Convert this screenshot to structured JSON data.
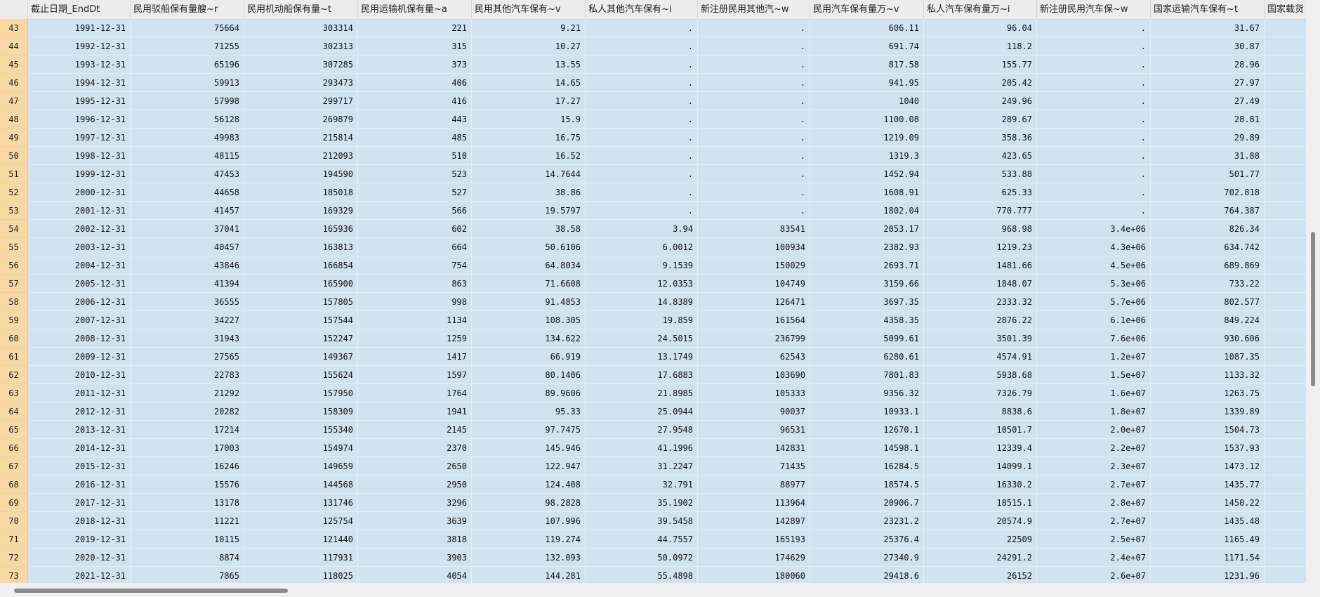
{
  "grid": {
    "columns": [
      "截止日期_EndDt",
      "民用驳船保有量艘~r",
      "民用机动船保有量~t",
      "民用运输机保有量~a",
      "民用其他汽车保有~v",
      "私人其他汽车保有~i",
      "新注册民用其他汽~w",
      "民用汽车保有量万~v",
      "私人汽车保有量万~i",
      "新注册民用汽车保~w",
      "国家运输汽车保有~t",
      "国家载货"
    ],
    "rows": [
      {
        "num": "43",
        "cells": [
          "1991-12-31",
          "75664",
          "303314",
          "221",
          "9.21",
          ".",
          ".",
          "606.11",
          "96.04",
          ".",
          "31.67",
          ""
        ]
      },
      {
        "num": "44",
        "cells": [
          "1992-12-31",
          "71255",
          "302313",
          "315",
          "10.27",
          ".",
          ".",
          "691.74",
          "118.2",
          ".",
          "30.87",
          ""
        ]
      },
      {
        "num": "45",
        "cells": [
          "1993-12-31",
          "65196",
          "307285",
          "373",
          "13.55",
          ".",
          ".",
          "817.58",
          "155.77",
          ".",
          "28.96",
          ""
        ]
      },
      {
        "num": "46",
        "cells": [
          "1994-12-31",
          "59913",
          "293473",
          "406",
          "14.65",
          ".",
          ".",
          "941.95",
          "205.42",
          ".",
          "27.97",
          ""
        ]
      },
      {
        "num": "47",
        "cells": [
          "1995-12-31",
          "57998",
          "299717",
          "416",
          "17.27",
          ".",
          ".",
          "1040",
          "249.96",
          ".",
          "27.49",
          ""
        ]
      },
      {
        "num": "48",
        "cells": [
          "1996-12-31",
          "56128",
          "269879",
          "443",
          "15.9",
          ".",
          ".",
          "1100.08",
          "289.67",
          ".",
          "28.81",
          ""
        ]
      },
      {
        "num": "49",
        "cells": [
          "1997-12-31",
          "49983",
          "215814",
          "485",
          "16.75",
          ".",
          ".",
          "1219.09",
          "358.36",
          ".",
          "29.89",
          ""
        ]
      },
      {
        "num": "50",
        "cells": [
          "1998-12-31",
          "48115",
          "212093",
          "510",
          "16.52",
          ".",
          ".",
          "1319.3",
          "423.65",
          ".",
          "31.88",
          ""
        ]
      },
      {
        "num": "51",
        "cells": [
          "1999-12-31",
          "47453",
          "194590",
          "523",
          "14.7644",
          ".",
          ".",
          "1452.94",
          "533.88",
          ".",
          "501.77",
          ""
        ]
      },
      {
        "num": "52",
        "cells": [
          "2000-12-31",
          "44658",
          "185018",
          "527",
          "38.86",
          ".",
          ".",
          "1608.91",
          "625.33",
          ".",
          "702.818",
          ""
        ]
      },
      {
        "num": "53",
        "cells": [
          "2001-12-31",
          "41457",
          "169329",
          "566",
          "19.5797",
          ".",
          ".",
          "1802.04",
          "770.777",
          ".",
          "764.387",
          ""
        ]
      },
      {
        "num": "54",
        "cells": [
          "2002-12-31",
          "37041",
          "165936",
          "602",
          "38.58",
          "3.94",
          "83541",
          "2053.17",
          "968.98",
          "3.4e+06",
          "826.34",
          ""
        ]
      },
      {
        "num": "55",
        "cells": [
          "2003-12-31",
          "40457",
          "163813",
          "664",
          "50.6106",
          "6.0012",
          "100934",
          "2382.93",
          "1219.23",
          "4.3e+06",
          "634.742",
          ""
        ]
      },
      {
        "num": "56",
        "cells": [
          "2004-12-31",
          "43846",
          "166854",
          "754",
          "64.8034",
          "9.1539",
          "150029",
          "2693.71",
          "1481.66",
          "4.5e+06",
          "689.869",
          ""
        ]
      },
      {
        "num": "57",
        "cells": [
          "2005-12-31",
          "41394",
          "165900",
          "863",
          "71.6608",
          "12.0353",
          "104749",
          "3159.66",
          "1848.07",
          "5.3e+06",
          "733.22",
          ""
        ]
      },
      {
        "num": "58",
        "cells": [
          "2006-12-31",
          "36555",
          "157805",
          "998",
          "91.4853",
          "14.8389",
          "126471",
          "3697.35",
          "2333.32",
          "5.7e+06",
          "802.577",
          ""
        ]
      },
      {
        "num": "59",
        "cells": [
          "2007-12-31",
          "34227",
          "157544",
          "1134",
          "108.305",
          "19.859",
          "161564",
          "4358.35",
          "2876.22",
          "6.1e+06",
          "849.224",
          ""
        ]
      },
      {
        "num": "60",
        "cells": [
          "2008-12-31",
          "31943",
          "152247",
          "1259",
          "134.622",
          "24.5015",
          "236799",
          "5099.61",
          "3501.39",
          "7.6e+06",
          "930.606",
          ""
        ]
      },
      {
        "num": "61",
        "cells": [
          "2009-12-31",
          "27565",
          "149367",
          "1417",
          "66.919",
          "13.1749",
          "62543",
          "6280.61",
          "4574.91",
          "1.2e+07",
          "1087.35",
          ""
        ]
      },
      {
        "num": "62",
        "cells": [
          "2010-12-31",
          "22783",
          "155624",
          "1597",
          "80.1406",
          "17.6883",
          "103690",
          "7801.83",
          "5938.68",
          "1.5e+07",
          "1133.32",
          ""
        ]
      },
      {
        "num": "63",
        "cells": [
          "2011-12-31",
          "21292",
          "157950",
          "1764",
          "89.9606",
          "21.8985",
          "105333",
          "9356.32",
          "7326.79",
          "1.6e+07",
          "1263.75",
          ""
        ]
      },
      {
        "num": "64",
        "cells": [
          "2012-12-31",
          "20282",
          "158309",
          "1941",
          "95.33",
          "25.0944",
          "90037",
          "10933.1",
          "8838.6",
          "1.8e+07",
          "1339.89",
          ""
        ]
      },
      {
        "num": "65",
        "cells": [
          "2013-12-31",
          "17214",
          "155340",
          "2145",
          "97.7475",
          "27.9548",
          "96531",
          "12670.1",
          "10501.7",
          "2.0e+07",
          "1504.73",
          ""
        ]
      },
      {
        "num": "66",
        "cells": [
          "2014-12-31",
          "17003",
          "154974",
          "2370",
          "145.946",
          "41.1996",
          "142831",
          "14598.1",
          "12339.4",
          "2.2e+07",
          "1537.93",
          ""
        ]
      },
      {
        "num": "67",
        "cells": [
          "2015-12-31",
          "16246",
          "149659",
          "2650",
          "122.947",
          "31.2247",
          "71435",
          "16284.5",
          "14099.1",
          "2.3e+07",
          "1473.12",
          ""
        ]
      },
      {
        "num": "68",
        "cells": [
          "2016-12-31",
          "15576",
          "144568",
          "2950",
          "124.408",
          "32.791",
          "88977",
          "18574.5",
          "16330.2",
          "2.7e+07",
          "1435.77",
          ""
        ]
      },
      {
        "num": "69",
        "cells": [
          "2017-12-31",
          "13178",
          "131746",
          "3296",
          "98.2828",
          "35.1902",
          "113964",
          "20906.7",
          "18515.1",
          "2.8e+07",
          "1450.22",
          ""
        ]
      },
      {
        "num": "70",
        "cells": [
          "2018-12-31",
          "11221",
          "125754",
          "3639",
          "107.996",
          "39.5458",
          "142897",
          "23231.2",
          "20574.9",
          "2.7e+07",
          "1435.48",
          ""
        ]
      },
      {
        "num": "71",
        "cells": [
          "2019-12-31",
          "10115",
          "121440",
          "3818",
          "119.274",
          "44.7557",
          "165193",
          "25376.4",
          "22509",
          "2.5e+07",
          "1165.49",
          ""
        ]
      },
      {
        "num": "72",
        "cells": [
          "2020-12-31",
          "8874",
          "117931",
          "3903",
          "132.093",
          "50.0972",
          "174629",
          "27340.9",
          "24291.2",
          "2.4e+07",
          "1171.54",
          ""
        ]
      },
      {
        "num": "73",
        "cells": [
          "2021-12-31",
          "7865",
          "118025",
          "4054",
          "144.281",
          "55.4898",
          "180060",
          "29418.6",
          "26152",
          "2.6e+07",
          "1231.96",
          ""
        ]
      }
    ]
  }
}
